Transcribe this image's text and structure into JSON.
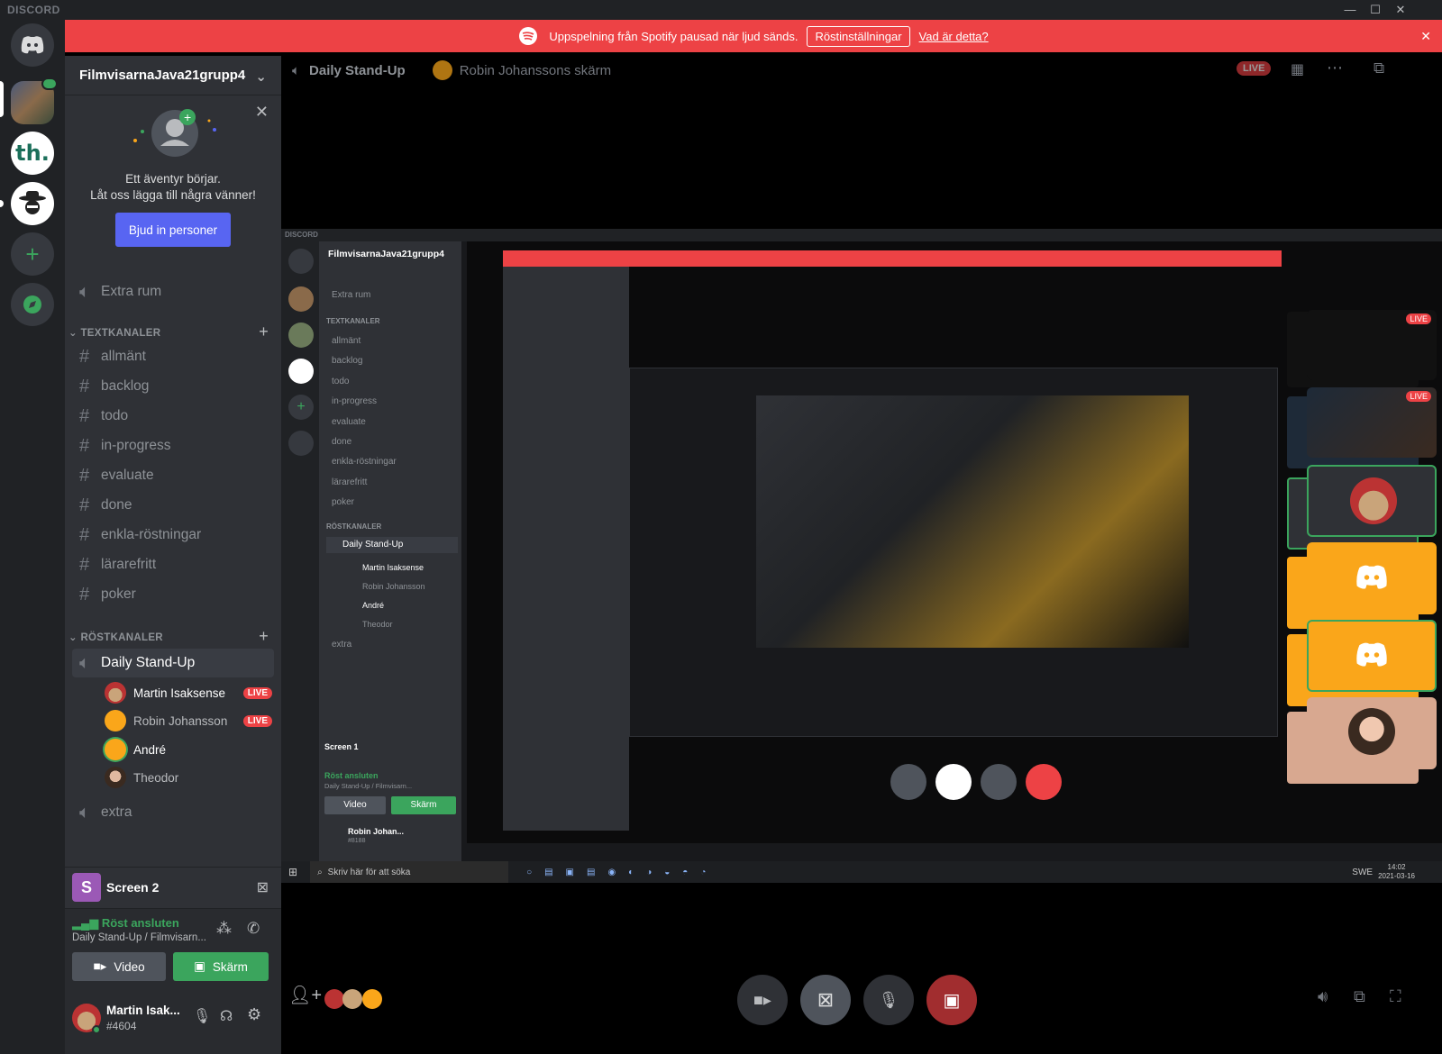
{
  "app": {
    "brand": "DISCORD"
  },
  "window_controls": {
    "minimize": "—",
    "maximize": "☐",
    "close": "✕"
  },
  "banner": {
    "message": "Uppspelning från Spotify pausad när ljud sänds.",
    "button": "Röstinställningar",
    "link": "Vad är detta?",
    "close": "✕"
  },
  "server": {
    "name": "FilmvisarnaJava21grupp4"
  },
  "invite": {
    "line1": "Ett äventyr börjar.",
    "line2": "Låt oss lägga till några vänner!",
    "button": "Bjud in personer"
  },
  "extra_room": "Extra rum",
  "text_category": "TEXTKANALER",
  "text_channels": [
    "allmänt",
    "backlog",
    "todo",
    "in-progress",
    "evaluate",
    "done",
    "enkla-röstningar",
    "lärarefritt",
    "poker"
  ],
  "voice_category": "RÖSTKANALER",
  "voice_channel": "Daily Stand-Up",
  "voice_users": [
    {
      "name": "Martin Isaksense",
      "live": "LIVE"
    },
    {
      "name": "Robin Johansson",
      "live": "LIVE"
    },
    {
      "name": "André",
      "live": ""
    },
    {
      "name": "Theodor",
      "live": ""
    }
  ],
  "extra_voice": "extra",
  "screen_panel": {
    "initial": "S",
    "title": "Screen 2"
  },
  "voice_status": {
    "title": "Röst ansluten",
    "subtitle": "Daily Stand-Up / Filmvisarn...",
    "video_button": "Video",
    "screen_button": "Skärm"
  },
  "user": {
    "name": "Martin Isak...",
    "tag": "#4604"
  },
  "call_header": {
    "channel": "Daily Stand-Up",
    "stream": "Robin Johanssons skärm",
    "live_badge": "LIVE"
  },
  "stream_content": {
    "brand": "DISCORD",
    "server": "FilmvisarnaJava21grupp4",
    "extra_room": "Extra rum",
    "text_category": "TEXTKANALER",
    "voice_category": "RÖSTKANALER",
    "voice_channel": "Daily Stand-Up",
    "voice_users": [
      "Martin Isaksense",
      "Robin Johansson",
      "André",
      "Theodor"
    ],
    "extra_voice": "extra",
    "screen_panel": "Screen 1",
    "voice_status": "Röst ansluten",
    "voice_sub": "Daily Stand-Up / Filmvisarn...",
    "video": "Video",
    "screen": "Skärm",
    "user": "Robin Johan...",
    "user_tag": "#8188",
    "taskbar_search": "Skriv här för att söka",
    "taskbar_lang": "SWE",
    "taskbar_time": "14:02",
    "taskbar_date": "2021-03-16"
  },
  "colors": {
    "accent": "#5865f2",
    "live": "#ed4245",
    "green": "#3ba55d",
    "sidebar": "#2f3136",
    "guilds": "#202225",
    "orange": "#faa61a"
  },
  "icons": [
    "discord-logo-icon",
    "add-server-icon",
    "explore-icon",
    "speaker-icon",
    "hash-icon",
    "plus-icon",
    "chevron-down-icon",
    "close-icon",
    "mic-icon",
    "headphones-icon",
    "gear-icon",
    "video-icon",
    "screen-share-icon",
    "signal-icon",
    "disconnect-icon",
    "grid-icon",
    "more-icon",
    "popout-icon",
    "volume-icon",
    "fullscreen-icon",
    "add-user-icon",
    "end-call-icon"
  ]
}
